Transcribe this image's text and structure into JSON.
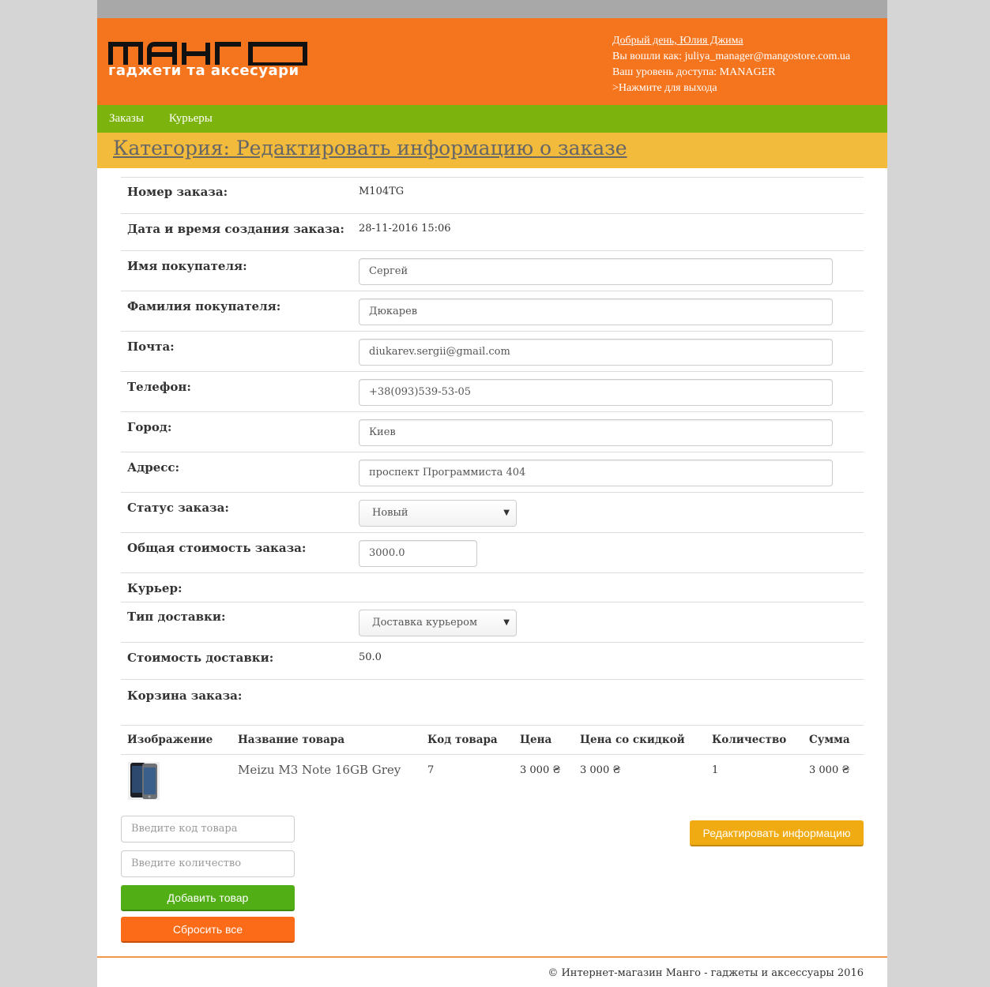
{
  "header": {
    "logo_main": "МАНГО",
    "logo_sub": "гаджети та аксесуари",
    "greeting": "Добрый день, Юлия Джима",
    "logged_in_as": "Вы вошли как: juliya_manager@mangostore.com.ua",
    "access_level": "Ваш уровень доступа: MANAGER",
    "logout": ">Нажмите для выхода"
  },
  "nav": {
    "items": [
      {
        "label": "Заказы"
      },
      {
        "label": "Курьеры"
      }
    ]
  },
  "category_title": "Категория: Редактировать информацию о заказе",
  "order": {
    "number_label": "Номер заказа:",
    "number_value": "M104TG",
    "date_label": "Дата и время создания заказа:",
    "date_value": "28-11-2016 15:06",
    "first_name_label": "Имя покупателя:",
    "first_name_value": "Сергей",
    "last_name_label": "Фамилия покупателя:",
    "last_name_value": "Дюкарев",
    "email_label": "Почта:",
    "email_value": "diukarev.sergii@gmail.com",
    "phone_label": "Телефон:",
    "phone_value": "+38(093)539-53-05",
    "city_label": "Город:",
    "city_value": "Киев",
    "address_label": "Адресс:",
    "address_value": "проспект Программиста 404",
    "status_label": "Статус заказа:",
    "status_value": "Новый",
    "total_label": "Общая стоимость заказа:",
    "total_value": "3000.0",
    "courier_label": "Курьер:",
    "delivery_type_label": "Тип доставки:",
    "delivery_type_value": "Доставка курьером",
    "delivery_cost_label": "Стоимость доставки:",
    "delivery_cost_value": "50.0",
    "cart_label": "Корзина заказа:"
  },
  "cart": {
    "columns": [
      "Изображение",
      "Название товара",
      "Код товара",
      "Цена",
      "Цена со скидкой",
      "Количество",
      "Сумма"
    ],
    "rows": [
      {
        "name": "Meizu M3 Note 16GB Grey",
        "code": "7",
        "price": "3 000 ₴",
        "discount_price": "3 000 ₴",
        "quantity": "1",
        "sum": "3 000 ₴"
      }
    ]
  },
  "actions": {
    "code_placeholder": "Введите код товара",
    "qty_placeholder": "Введите количество",
    "add_button": "Добавить товар",
    "reset_button": "Сбросить все",
    "edit_button": "Редактировать информацию"
  },
  "footer": {
    "text": "© Интернет-магазин Манго - гаджеты и аксессуары 2016"
  },
  "colors": {
    "header_bg": "#f5751f",
    "nav_bg": "#7db30d",
    "category_bg": "#f2bb3c",
    "add_button": "#51ae14",
    "reset_button": "#fc6b17",
    "edit_button": "#f1ab12"
  }
}
